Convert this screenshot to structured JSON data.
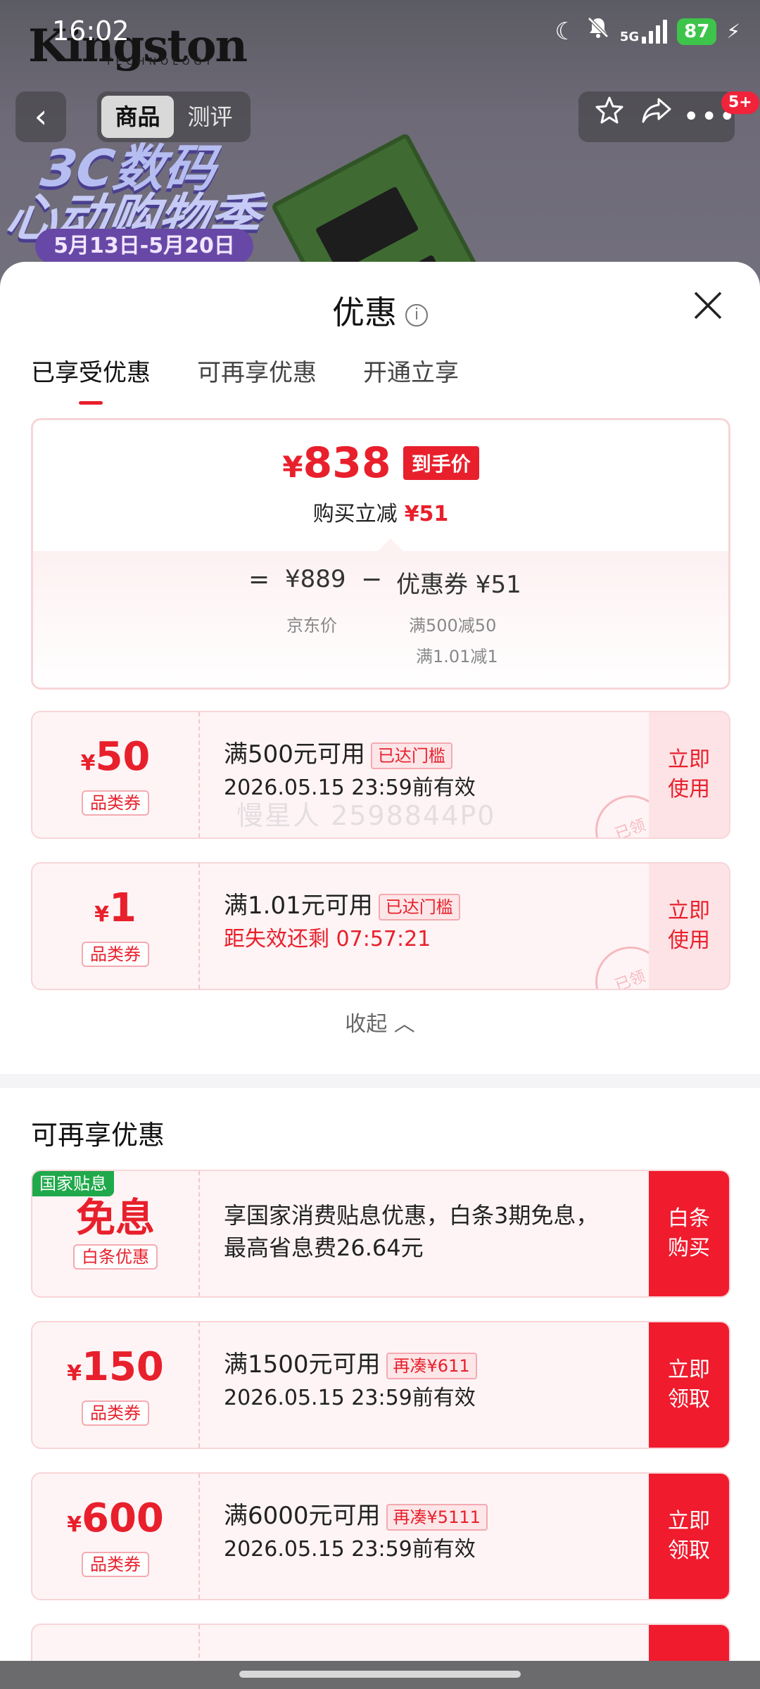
{
  "status_bar": {
    "time": "16:02",
    "network": "5G",
    "battery": "87"
  },
  "banner": {
    "brand": "Kingston",
    "brand_sub": "TECHNOLOGY",
    "promo_line1": "3C数码",
    "promo_line2": "心动购物季",
    "promo_date": "5月13日-5月20日"
  },
  "nav": {
    "back_icon": "chevron-left-icon",
    "tabs": [
      "商品",
      "测评"
    ],
    "active_tab": "商品",
    "badge": "5+"
  },
  "sheet": {
    "title": "优惠",
    "tabs": [
      "已享受优惠",
      "可再享优惠",
      "开通立享"
    ],
    "active_tab": 0
  },
  "price_card": {
    "final_price_symbol": "¥",
    "final_price": "838",
    "final_tag": "到手价",
    "reduce_label": "购买立减",
    "reduce_amount": "¥51",
    "eq": "=",
    "jd_price": "¥889",
    "minus": "−",
    "coupon_total": "优惠券 ¥51",
    "jd_label": "京东价",
    "coupon_detail_1": "满500减50",
    "coupon_detail_2": "满1.01减1"
  },
  "enjoyed_coupons": [
    {
      "amount": "50",
      "type": "品类券",
      "condition": "满500元可用",
      "badge": "已达门槛",
      "expiry": "2026.05.15 23:59前有效",
      "action": "立即\n使用",
      "stamp": "已领"
    },
    {
      "amount": "1",
      "type": "品类券",
      "condition": "满1.01元可用",
      "badge": "已达门槛",
      "expiry": "距失效还剩 07:57:21",
      "action": "立即\n使用",
      "stamp": "已领"
    }
  ],
  "watermark": "慢星人 2598844P0",
  "collapse_label": "收起",
  "more_section": {
    "title": "可再享优惠",
    "baitiao": {
      "tag": "国家贴息",
      "big_text": "免息",
      "type": "白条优惠",
      "desc": "享国家消费贴息优惠，白条3期免息，最高省息费26.64元",
      "action": "白条\n购买"
    },
    "coupons": [
      {
        "amount": "150",
        "type": "品类券",
        "condition": "满1500元可用",
        "badge": "再凑¥611",
        "expiry": "2026.05.15 23:59前有效",
        "action": "立即\n领取"
      },
      {
        "amount": "600",
        "type": "品类券",
        "condition": "满6000元可用",
        "badge": "再凑¥5111",
        "expiry": "2026.05.15 23:59前有效",
        "action": "立即\n领取"
      }
    ]
  },
  "colors": {
    "accent": "#e8202c",
    "gov_green": "#1fa94a"
  }
}
